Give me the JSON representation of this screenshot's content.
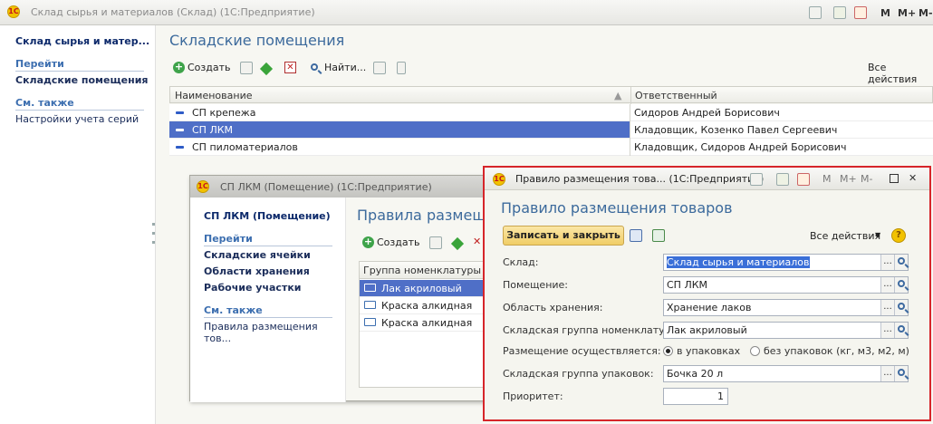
{
  "main": {
    "title": "Склад сырья и материалов (Склад)  (1С:Предприятие)",
    "topbar_m": [
      "M",
      "M+",
      "M-"
    ],
    "nav": {
      "header": "Склад сырья и матер...",
      "goto_label": "Перейти",
      "goto_items": [
        "Складские помещения"
      ],
      "also_label": "См. также",
      "also_items": [
        "Настройки учета серий"
      ]
    },
    "content": {
      "title": "Складские помещения",
      "toolbar": {
        "create": "Создать",
        "find": "Найти...",
        "all_actions": "Все действия"
      },
      "columns": [
        "Наименование",
        "Ответственный"
      ],
      "rows": [
        {
          "name": "СП крепежа",
          "responsible": "Сидоров Андрей Борисович"
        },
        {
          "name": "СП ЛКМ",
          "responsible": "Кладовщик, Козенко Павел Сергеевич"
        },
        {
          "name": "СП пиломатериалов",
          "responsible": "Кладовщик, Сидоров Андрей Борисович"
        }
      ]
    }
  },
  "room_window": {
    "title": "СП ЛКМ (Помещение)  (1С:Предприятие)",
    "nav": {
      "header": "СП ЛКМ (Помещение)",
      "goto_label": "Перейти",
      "goto_items": [
        "Складские ячейки",
        "Области хранения",
        "Рабочие участки"
      ],
      "also_label": "См. также",
      "also_items": [
        "Правила размещения тов..."
      ]
    },
    "content": {
      "title": "Правила размещ",
      "create": "Создать",
      "column": "Группа номенклатуры",
      "rows": [
        "Лак акриловый",
        "Краска алкидная",
        "Краска алкидная"
      ]
    }
  },
  "dialog": {
    "title": "Правило размещения това...  (1С:Предприятие)",
    "m_items": [
      "M",
      "M+",
      "M-"
    ],
    "heading": "Правило размещения товаров",
    "save_close": "Записать и закрыть",
    "all_actions": "Все действия",
    "help": "?",
    "fields": {
      "warehouse": {
        "label": "Склад:",
        "value": "Склад сырья и материалов"
      },
      "room": {
        "label": "Помещение:",
        "value": "СП ЛКМ"
      },
      "area": {
        "label": "Область хранения:",
        "value": "Хранение лаков"
      },
      "group": {
        "label": "Складская группа номенклатуры:",
        "value": "Лак акриловый"
      },
      "placement": {
        "label": "Размещение осуществляется:",
        "option_on": "в упаковках",
        "option_off": "без упаковок (кг, м3, м2, м)"
      },
      "pack_group": {
        "label": "Складская группа упаковок:",
        "value": "Бочка 20 л"
      },
      "priority": {
        "label": "Приоритет:",
        "value": "1"
      }
    }
  }
}
